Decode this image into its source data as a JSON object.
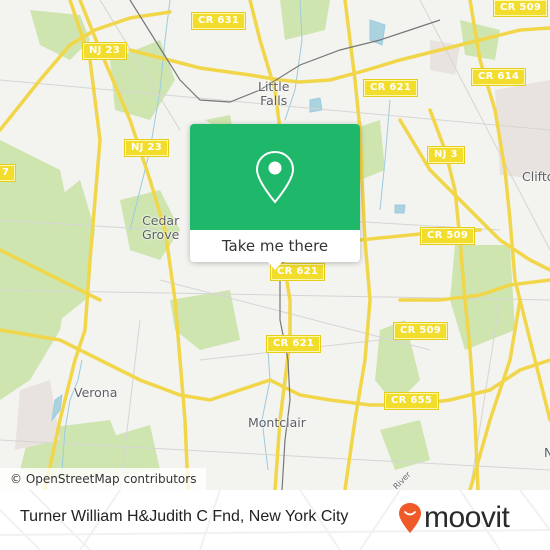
{
  "map": {
    "road_labels": [
      {
        "id": "cr631",
        "text": "CR 631"
      },
      {
        "id": "cr509-top",
        "text": "CR 509"
      },
      {
        "id": "nj23-top",
        "text": "NJ 23"
      },
      {
        "id": "cr614",
        "text": "CR 614"
      },
      {
        "id": "cr621-top",
        "text": "CR 621"
      },
      {
        "id": "nj23-left",
        "text": "NJ 23"
      },
      {
        "id": "nj3",
        "text": "NJ 3"
      },
      {
        "id": "left-edge",
        "text": "7"
      },
      {
        "id": "cr509-mid",
        "text": "CR 509"
      },
      {
        "id": "cr621-pin",
        "text": "CR 621"
      },
      {
        "id": "cr509-low",
        "text": "CR 509"
      },
      {
        "id": "cr621-low",
        "text": "CR 621"
      },
      {
        "id": "cr655",
        "text": "CR 655"
      }
    ],
    "place_labels": [
      {
        "id": "little-falls",
        "text": "Little\nFalls"
      },
      {
        "id": "cedar-grove",
        "text": "Cedar\nGrove"
      },
      {
        "id": "clifton",
        "text": "Clifton"
      },
      {
        "id": "verona",
        "text": "Verona"
      },
      {
        "id": "montclair",
        "text": "Montclair"
      },
      {
        "id": "n-edge",
        "text": "N"
      },
      {
        "id": "river",
        "text": "River"
      }
    ],
    "attribution": "© OpenStreetMap contributors"
  },
  "popup": {
    "icon": "map-pin-icon",
    "cta_label": "Take me there",
    "accent_color": "#1fb86a"
  },
  "footer": {
    "title": "Turner William H&Judith C Fnd, New York City",
    "brand": "moovit",
    "brand_color": "#f05a28"
  }
}
